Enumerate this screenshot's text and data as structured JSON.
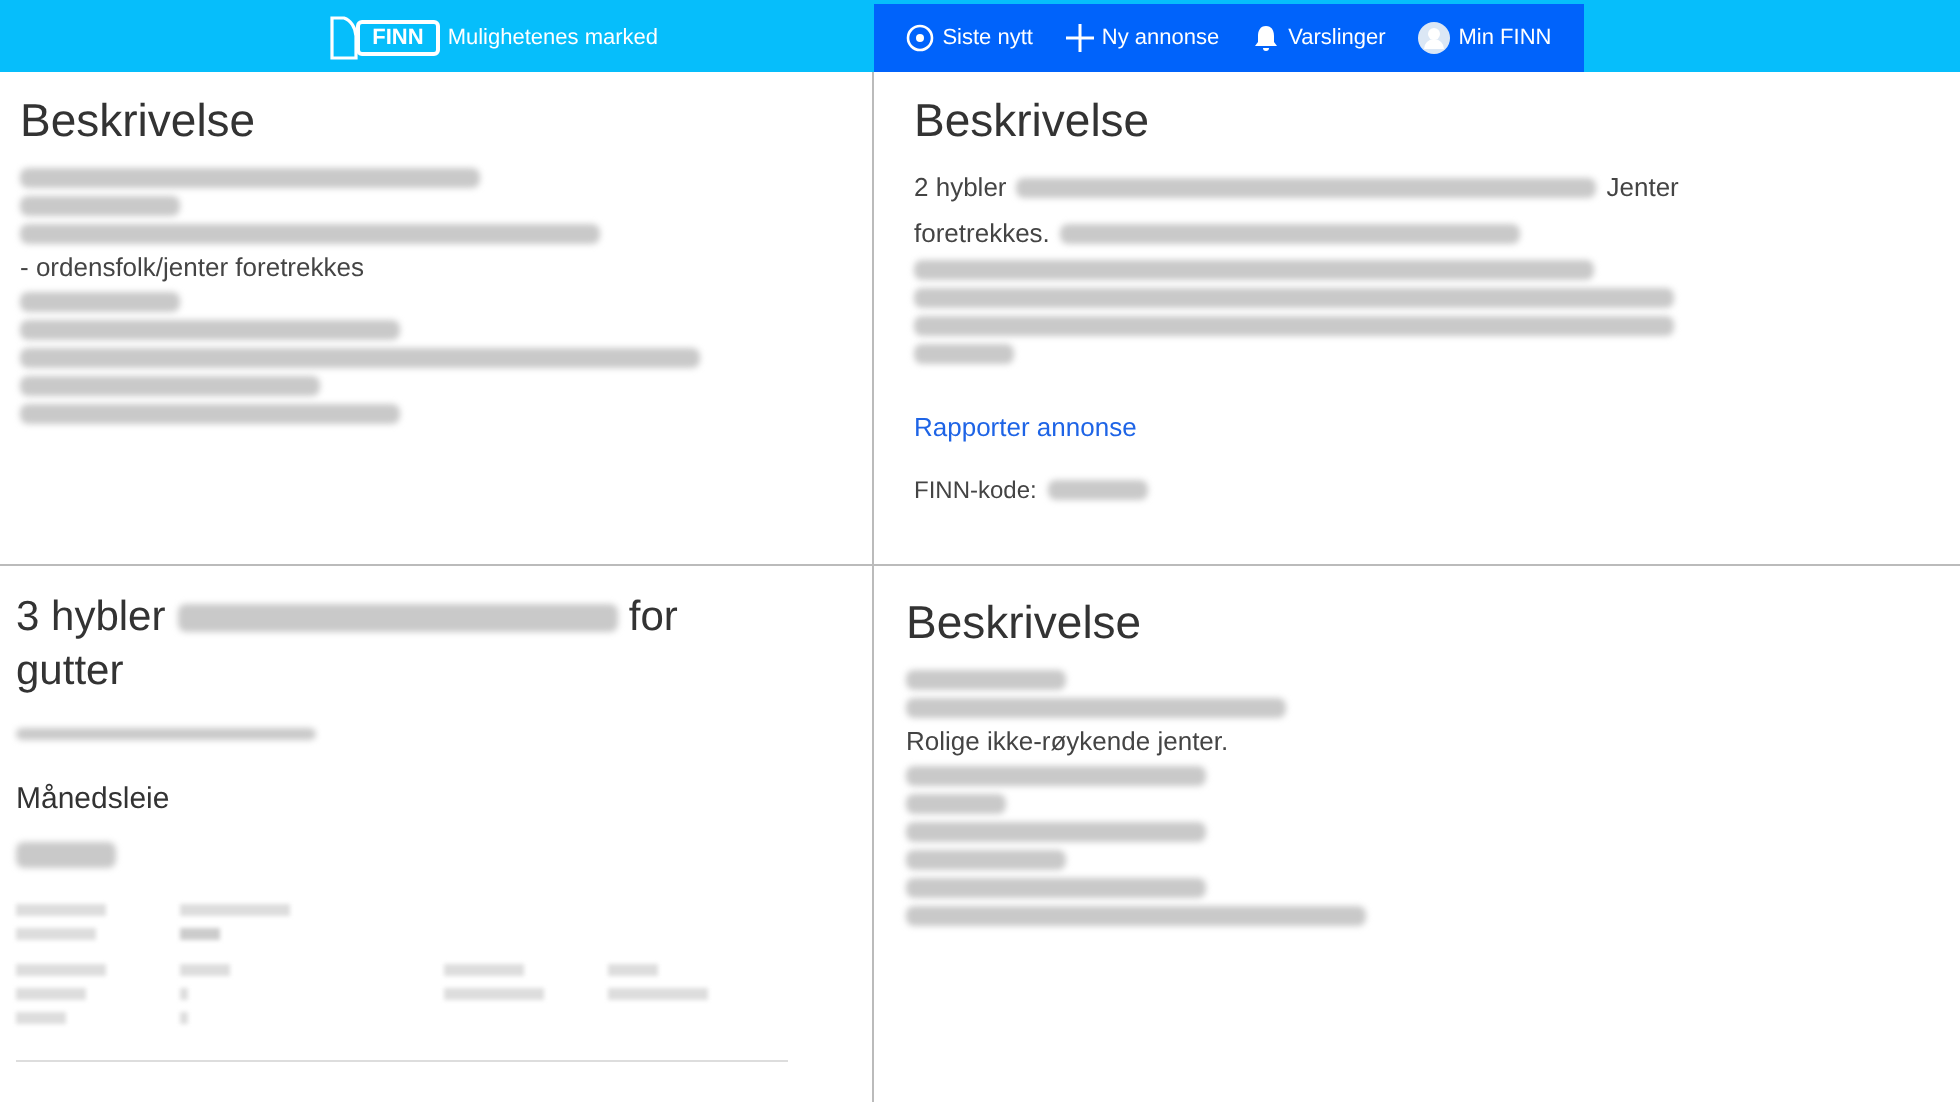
{
  "header": {
    "logo": "FINN",
    "tagline": "Mulighetenes marked",
    "nav": [
      {
        "label": "Siste nytt"
      },
      {
        "label": "Ny annonse"
      },
      {
        "label": "Varslinger"
      },
      {
        "label": "Min FINN"
      }
    ]
  },
  "panels": [
    {
      "title": [
        {
          "kind": "text",
          "text": "Beskrivelse"
        }
      ],
      "lines": [
        [
          {
            "kind": "redacted"
          }
        ],
        [
          {
            "kind": "redacted"
          }
        ],
        [
          {
            "kind": "redacted"
          }
        ],
        [
          {
            "kind": "text",
            "text": "- ordensfolk/jenter foretrekkes"
          }
        ],
        [
          {
            "kind": "redacted"
          }
        ],
        [
          {
            "kind": "redacted"
          }
        ],
        [
          {
            "kind": "redacted"
          }
        ],
        [
          {
            "kind": "redacted"
          }
        ],
        [
          {
            "kind": "redacted"
          }
        ]
      ]
    },
    {
      "title": [
        {
          "kind": "text",
          "text": "Beskrivelse"
        }
      ],
      "lines": [
        [
          {
            "kind": "text",
            "text": "2 hybler"
          },
          {
            "kind": "redacted"
          },
          {
            "kind": "text",
            "text": "Jenter"
          }
        ],
        [
          {
            "kind": "text",
            "text": "foretrekkes."
          },
          {
            "kind": "redacted"
          }
        ],
        [
          {
            "kind": "redacted"
          }
        ],
        [
          {
            "kind": "redacted"
          }
        ],
        [
          {
            "kind": "redacted"
          }
        ],
        [
          {
            "kind": "redacted"
          }
        ]
      ],
      "link": "Rapporter annonse",
      "code_label": "FINN-kode:"
    },
    {
      "title": [
        {
          "kind": "text",
          "text": "3 hybler"
        },
        {
          "kind": "redacted"
        },
        {
          "kind": "text",
          "text": "for gutter"
        }
      ],
      "subtitle": [
        {
          "kind": "redacted"
        }
      ],
      "price_label": "Månedsleie"
    },
    {
      "title": [
        {
          "kind": "text",
          "text": "Beskrivelse"
        }
      ],
      "lines": [
        [
          {
            "kind": "redacted"
          }
        ],
        [
          {
            "kind": "redacted"
          }
        ],
        [
          {
            "kind": "text",
            "text": "Rolige ikke-røykende jenter."
          }
        ],
        [
          {
            "kind": "redacted"
          }
        ],
        [
          {
            "kind": "redacted"
          }
        ],
        [
          {
            "kind": "redacted"
          }
        ],
        [
          {
            "kind": "redacted"
          }
        ],
        [
          {
            "kind": "redacted"
          }
        ],
        [
          {
            "kind": "redacted"
          }
        ]
      ]
    }
  ]
}
